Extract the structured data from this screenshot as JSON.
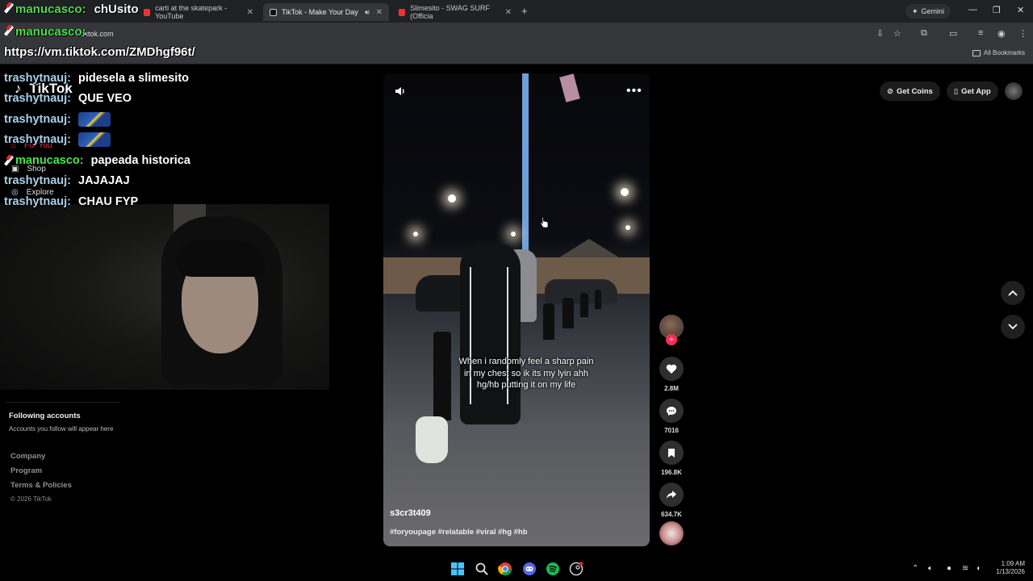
{
  "browser": {
    "tabs": [
      {
        "title": "carti at the skatepark - YouTube",
        "active": false
      },
      {
        "title": "TikTok - Make Your Day",
        "active": true
      },
      {
        "title": "Slimesito - SWAG SURF (Officia",
        "active": false
      }
    ],
    "gemini_label": "Gemini",
    "address": "tiktok.com",
    "bookmarks_label": "All Bookmarks"
  },
  "overlay": {
    "title_user": "manucasco:",
    "title_text": "chUsito",
    "sub_user": "manucasco:",
    "url": "https://vm.tiktok.com/ZMDhgf96t/"
  },
  "chat": [
    {
      "user": "trashytnauj:",
      "color": "blue",
      "message": "pidesela a slimesito"
    },
    {
      "user": "trashytnauj:",
      "color": "blue",
      "message": "QUE VEO"
    },
    {
      "user": "trashytnauj:",
      "color": "blue",
      "message": "",
      "emote": true
    },
    {
      "user": "trashytnauj:",
      "color": "blue",
      "message": "",
      "emote": true
    },
    {
      "user": "manucasco:",
      "color": "green",
      "message": "papeada historica",
      "pencil": true
    },
    {
      "user": "trashytnauj:",
      "color": "blue",
      "message": "JAJAJAJ"
    },
    {
      "user": "trashytnauj:",
      "color": "blue",
      "message": "CHAU FYP"
    }
  ],
  "tiktok": {
    "logo": "TikTok",
    "nav": {
      "for_you": "For You",
      "shop": "Shop",
      "explore": "Explore"
    },
    "following_title": "Following accounts",
    "following_sub": "Accounts you follow will appear here",
    "footer": {
      "company": "Company",
      "program": "Program",
      "terms": "Terms & Policies",
      "copyright": "© 2026 TikTok"
    },
    "get_coins": "Get Coins",
    "get_app": "Get App",
    "video": {
      "caption": "When i randomly feel a sharp pain in my chest so ik its my lyin ahh hg/hb putting it on my life",
      "author": "s3cr3t409",
      "hashtags": "#foryoupage #relatable #viral #hg #hb"
    },
    "actions": {
      "likes": "2.8M",
      "comments": "7016",
      "saves": "196.8K",
      "shares": "634.7K"
    }
  },
  "taskbar": {
    "time": "1:09 AM",
    "date": "1/13/2026"
  },
  "colors": {
    "chat_green": "#4ee04e",
    "chat_blue": "#a9cfe8",
    "accent": "#fe2c55"
  }
}
